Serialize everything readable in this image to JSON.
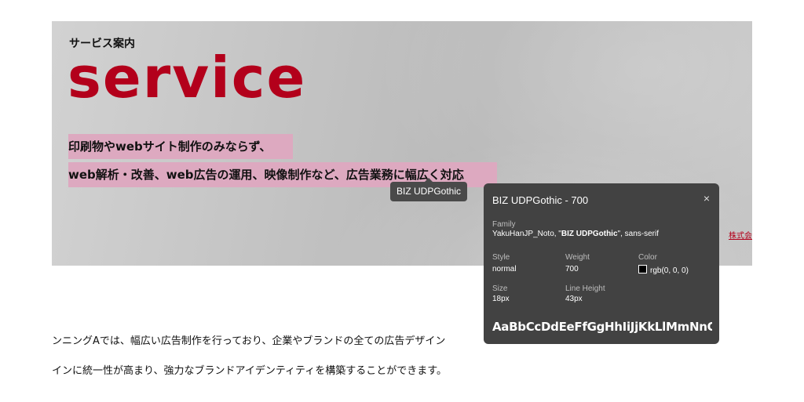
{
  "hero": {
    "subtitle": "サービス案内",
    "heading": "service",
    "line1": "印刷物やwebサイト制作のみならず、",
    "line2": "web解析・改善、web広告の運用、映像制作など、広告業務に幅広く対応",
    "corp_link": "株式会"
  },
  "tooltip": {
    "label": "BIZ UDPGothic"
  },
  "font_panel": {
    "title": "BIZ UDPGothic - 700",
    "close": "×",
    "family_label": "Family",
    "family_prefix": "YakuHanJP_Noto, \"",
    "family_bold": "BIZ UDPGothic",
    "family_suffix": "\", sans-serif",
    "style_label": "Style",
    "style_value": "normal",
    "weight_label": "Weight",
    "weight_value": "700",
    "color_label": "Color",
    "color_value": "rgb(0, 0, 0)",
    "size_label": "Size",
    "size_value": "18px",
    "lineheight_label": "Line Height",
    "lineheight_value": "43px",
    "sample": "AaBbCcDdEeFfGgHhIiJjKkLlMmNnO"
  },
  "body": {
    "p1": "ンニングAでは、幅広い広告制作を行っており、企業やブランドの全ての広告デザイン",
    "p2": "インに統一性が高まり、強力なブランドアイデンティティを構築することができます。"
  },
  "colors": {
    "accent": "#b3001b",
    "highlight": "#dda9c0",
    "panel_bg": "#424242"
  }
}
